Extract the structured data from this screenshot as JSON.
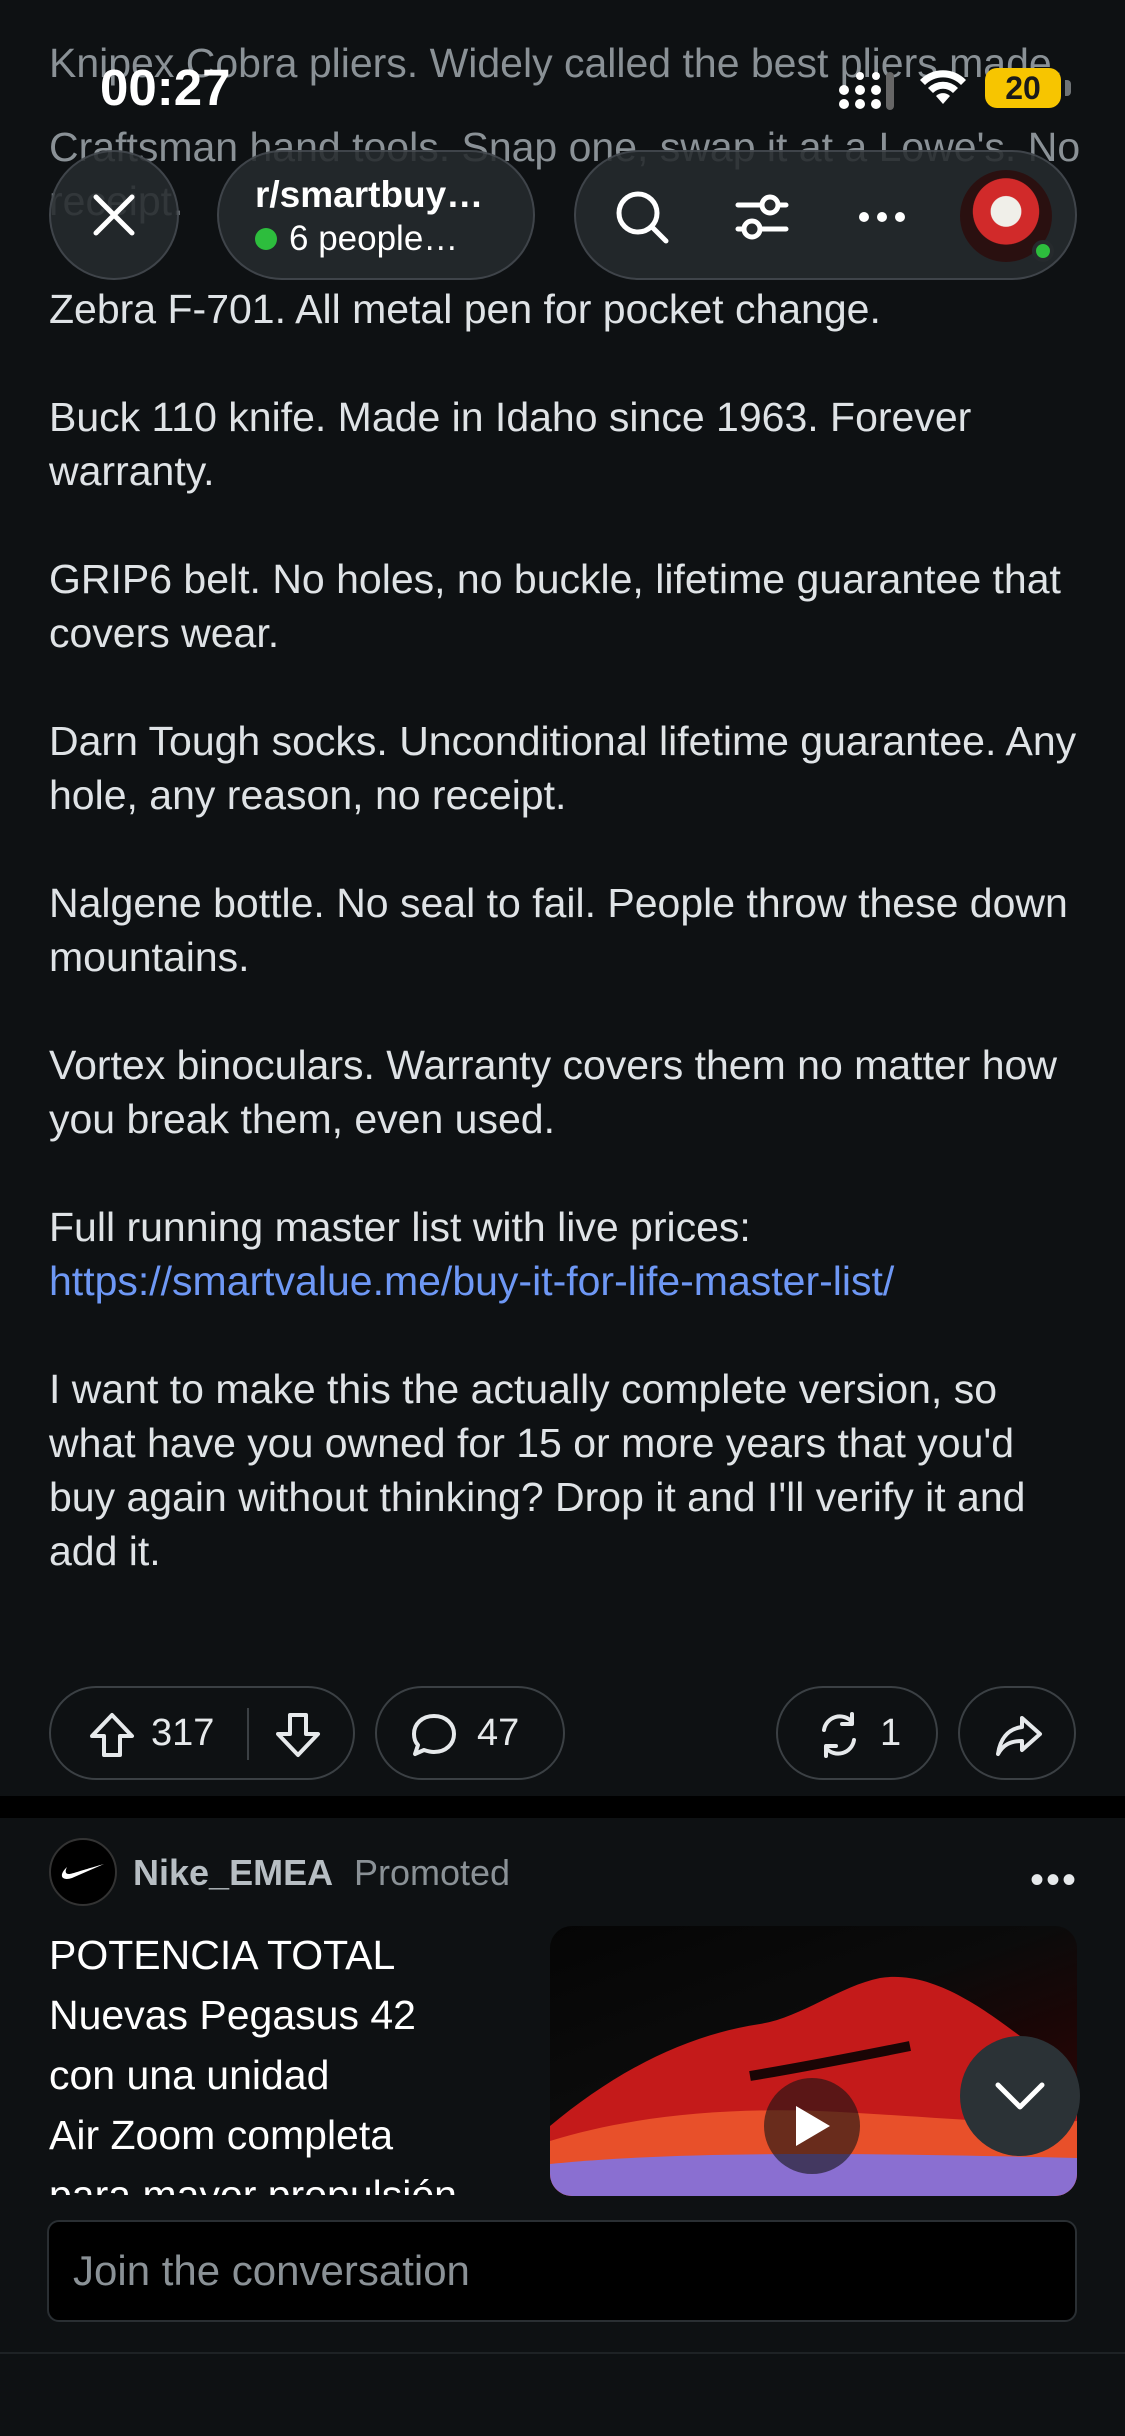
{
  "status_bar": {
    "time": "00:27",
    "battery": "20"
  },
  "header": {
    "subreddit": "r/smartbuy…",
    "online": "6 people…"
  },
  "post": {
    "paragraphs": [
      "Knipex Cobra pliers. Widely called the best pliers made.",
      "Craftsman hand tools. Snap one, swap it at a Lowe's. No receipt.",
      "Zebra F-701. All metal pen for pocket change.",
      "Buck 110 knife. Made in Idaho since 1963. Forever warranty.",
      "GRIP6 belt. No holes, no buckle, lifetime guarantee that covers wear.",
      "Darn Tough socks. Unconditional lifetime guarantee. Any hole, any reason, no receipt.",
      "Nalgene bottle. No seal to fail. People throw these down mountains.",
      "Vortex binoculars. Warranty covers them no matter how you break them, even used."
    ],
    "link_intro": "Full running master list with live prices: ",
    "link_url": "https://smartvalue.me/buy-it-for-life-master-list/",
    "closing": "I want to make this the actually complete version, so what have you owned for 15 or more years that you'd buy again without thinking? Drop it and I'll verify it and add it."
  },
  "actions": {
    "upvotes": "317",
    "comments": "47",
    "crossposts": "1"
  },
  "promoted": {
    "author": "Nike_EMEA",
    "label": "Promoted",
    "text_lines": [
      "POTENCIA TOTAL",
      "Nuevas Pegasus 42",
      "con una unidad",
      "Air Zoom completa",
      "para mayor propulsión"
    ]
  },
  "composer": {
    "placeholder": "Join the conversation"
  },
  "colors": {
    "background": "#0e1113",
    "link": "#6e98f5",
    "online": "#2dbd3d",
    "battery": "#f7c500"
  }
}
